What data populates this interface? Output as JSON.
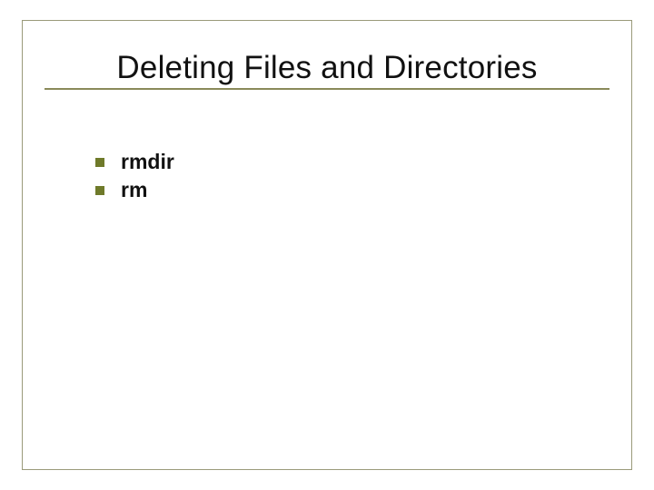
{
  "slide": {
    "title": "Deleting Files and Directories",
    "bullets": [
      {
        "text": "rmdir"
      },
      {
        "text": "rm"
      }
    ]
  },
  "colors": {
    "frame": "#9a9a7a",
    "underline": "#8a8a5a",
    "bullet": "#6f7a2a"
  }
}
